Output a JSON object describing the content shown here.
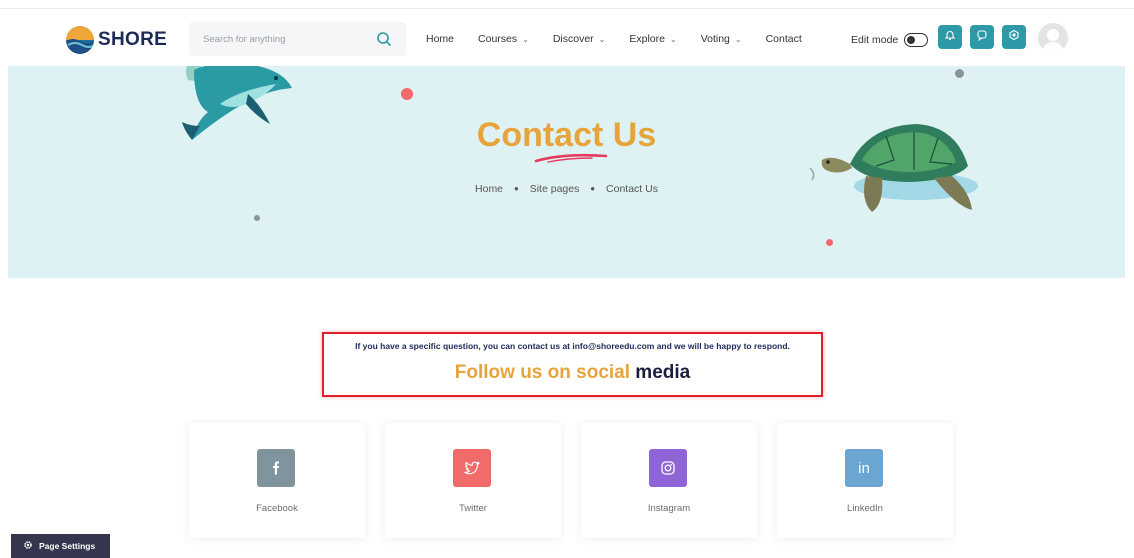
{
  "brand": {
    "name": "SHORE"
  },
  "search": {
    "placeholder": "Search for anything"
  },
  "nav": [
    {
      "label": "Home",
      "dropdown": false
    },
    {
      "label": "Courses",
      "dropdown": true
    },
    {
      "label": "Discover",
      "dropdown": true
    },
    {
      "label": "Explore",
      "dropdown": true
    },
    {
      "label": "Voting",
      "dropdown": true
    },
    {
      "label": "Contact",
      "dropdown": false
    }
  ],
  "header": {
    "edit_mode_label": "Edit mode",
    "icons": [
      "bell-icon",
      "chat-icon",
      "settings-icon"
    ]
  },
  "hero": {
    "title": "Contact Us",
    "breadcrumb": [
      "Home",
      "Site pages",
      "Contact Us"
    ]
  },
  "contact": {
    "text": "If you have a specific question, you can contact us at info@shoreedu.com and we will be happy to respond.",
    "follow_a": "Follow us on social",
    "follow_b": "media"
  },
  "social": [
    {
      "label": "Facebook",
      "icon": "facebook-icon",
      "color": "#7f949d"
    },
    {
      "label": "Twitter",
      "icon": "twitter-icon",
      "color": "#f26b6b"
    },
    {
      "label": "Instagram",
      "icon": "instagram-icon",
      "color": "#8e64d6"
    },
    {
      "label": "LinkedIn",
      "icon": "linkedin-icon",
      "color": "#6ba5d1"
    }
  ],
  "footer": {
    "page_settings_label": "Page Settings"
  },
  "colors": {
    "accent": "#2f9aa7",
    "title": "#e7a43c",
    "highlight": "#e0202a",
    "hero_bg": "#dff2f3"
  }
}
